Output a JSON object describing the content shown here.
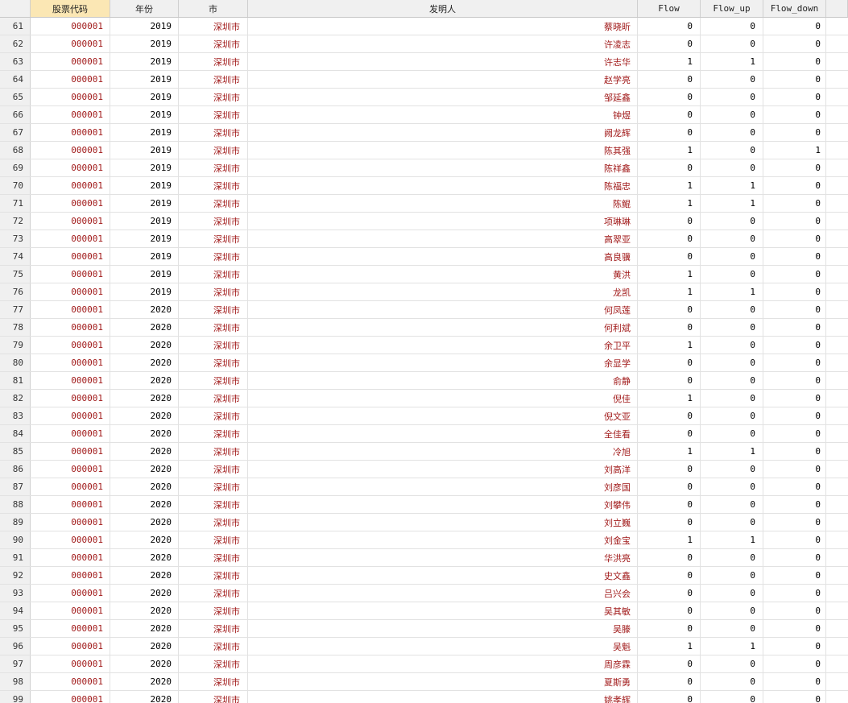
{
  "columns": {
    "code": "股票代码",
    "year": "年份",
    "city": "市",
    "inventor": "发明人",
    "flow": "Flow",
    "flow_up": "Flow_up",
    "flow_down": "Flow_down"
  },
  "rows": [
    {
      "idx": "61",
      "code": "000001",
      "year": "2019",
      "city": "深圳市",
      "inventor": "蔡晓昕",
      "flow": "0",
      "up": "0",
      "down": "0"
    },
    {
      "idx": "62",
      "code": "000001",
      "year": "2019",
      "city": "深圳市",
      "inventor": "许凌志",
      "flow": "0",
      "up": "0",
      "down": "0"
    },
    {
      "idx": "63",
      "code": "000001",
      "year": "2019",
      "city": "深圳市",
      "inventor": "许志华",
      "flow": "1",
      "up": "1",
      "down": "0"
    },
    {
      "idx": "64",
      "code": "000001",
      "year": "2019",
      "city": "深圳市",
      "inventor": "赵学亮",
      "flow": "0",
      "up": "0",
      "down": "0"
    },
    {
      "idx": "65",
      "code": "000001",
      "year": "2019",
      "city": "深圳市",
      "inventor": "邹延鑫",
      "flow": "0",
      "up": "0",
      "down": "0"
    },
    {
      "idx": "66",
      "code": "000001",
      "year": "2019",
      "city": "深圳市",
      "inventor": "钟煜",
      "flow": "0",
      "up": "0",
      "down": "0"
    },
    {
      "idx": "67",
      "code": "000001",
      "year": "2019",
      "city": "深圳市",
      "inventor": "阙龙辉",
      "flow": "0",
      "up": "0",
      "down": "0"
    },
    {
      "idx": "68",
      "code": "000001",
      "year": "2019",
      "city": "深圳市",
      "inventor": "陈其强",
      "flow": "1",
      "up": "0",
      "down": "1"
    },
    {
      "idx": "69",
      "code": "000001",
      "year": "2019",
      "city": "深圳市",
      "inventor": "陈祥鑫",
      "flow": "0",
      "up": "0",
      "down": "0"
    },
    {
      "idx": "70",
      "code": "000001",
      "year": "2019",
      "city": "深圳市",
      "inventor": "陈福忠",
      "flow": "1",
      "up": "1",
      "down": "0"
    },
    {
      "idx": "71",
      "code": "000001",
      "year": "2019",
      "city": "深圳市",
      "inventor": "陈鲲",
      "flow": "1",
      "up": "1",
      "down": "0"
    },
    {
      "idx": "72",
      "code": "000001",
      "year": "2019",
      "city": "深圳市",
      "inventor": "项琳琳",
      "flow": "0",
      "up": "0",
      "down": "0"
    },
    {
      "idx": "73",
      "code": "000001",
      "year": "2019",
      "city": "深圳市",
      "inventor": "高翠亚",
      "flow": "0",
      "up": "0",
      "down": "0"
    },
    {
      "idx": "74",
      "code": "000001",
      "year": "2019",
      "city": "深圳市",
      "inventor": "高良骥",
      "flow": "0",
      "up": "0",
      "down": "0"
    },
    {
      "idx": "75",
      "code": "000001",
      "year": "2019",
      "city": "深圳市",
      "inventor": "黄洪",
      "flow": "1",
      "up": "0",
      "down": "0"
    },
    {
      "idx": "76",
      "code": "000001",
      "year": "2019",
      "city": "深圳市",
      "inventor": "龙凯",
      "flow": "1",
      "up": "1",
      "down": "0"
    },
    {
      "idx": "77",
      "code": "000001",
      "year": "2020",
      "city": "深圳市",
      "inventor": "何凤莲",
      "flow": "0",
      "up": "0",
      "down": "0"
    },
    {
      "idx": "78",
      "code": "000001",
      "year": "2020",
      "city": "深圳市",
      "inventor": "何利斌",
      "flow": "0",
      "up": "0",
      "down": "0"
    },
    {
      "idx": "79",
      "code": "000001",
      "year": "2020",
      "city": "深圳市",
      "inventor": "余卫平",
      "flow": "1",
      "up": "0",
      "down": "0"
    },
    {
      "idx": "80",
      "code": "000001",
      "year": "2020",
      "city": "深圳市",
      "inventor": "余显学",
      "flow": "0",
      "up": "0",
      "down": "0"
    },
    {
      "idx": "81",
      "code": "000001",
      "year": "2020",
      "city": "深圳市",
      "inventor": "俞静",
      "flow": "0",
      "up": "0",
      "down": "0"
    },
    {
      "idx": "82",
      "code": "000001",
      "year": "2020",
      "city": "深圳市",
      "inventor": "倪佳",
      "flow": "1",
      "up": "0",
      "down": "0"
    },
    {
      "idx": "83",
      "code": "000001",
      "year": "2020",
      "city": "深圳市",
      "inventor": "倪文亚",
      "flow": "0",
      "up": "0",
      "down": "0"
    },
    {
      "idx": "84",
      "code": "000001",
      "year": "2020",
      "city": "深圳市",
      "inventor": "全佳看",
      "flow": "0",
      "up": "0",
      "down": "0"
    },
    {
      "idx": "85",
      "code": "000001",
      "year": "2020",
      "city": "深圳市",
      "inventor": "冷旭",
      "flow": "1",
      "up": "1",
      "down": "0"
    },
    {
      "idx": "86",
      "code": "000001",
      "year": "2020",
      "city": "深圳市",
      "inventor": "刘高洋",
      "flow": "0",
      "up": "0",
      "down": "0"
    },
    {
      "idx": "87",
      "code": "000001",
      "year": "2020",
      "city": "深圳市",
      "inventor": "刘彦国",
      "flow": "0",
      "up": "0",
      "down": "0"
    },
    {
      "idx": "88",
      "code": "000001",
      "year": "2020",
      "city": "深圳市",
      "inventor": "刘攀伟",
      "flow": "0",
      "up": "0",
      "down": "0"
    },
    {
      "idx": "89",
      "code": "000001",
      "year": "2020",
      "city": "深圳市",
      "inventor": "刘立巍",
      "flow": "0",
      "up": "0",
      "down": "0"
    },
    {
      "idx": "90",
      "code": "000001",
      "year": "2020",
      "city": "深圳市",
      "inventor": "刘金宝",
      "flow": "1",
      "up": "1",
      "down": "0"
    },
    {
      "idx": "91",
      "code": "000001",
      "year": "2020",
      "city": "深圳市",
      "inventor": "华洪亮",
      "flow": "0",
      "up": "0",
      "down": "0"
    },
    {
      "idx": "92",
      "code": "000001",
      "year": "2020",
      "city": "深圳市",
      "inventor": "史文鑫",
      "flow": "0",
      "up": "0",
      "down": "0"
    },
    {
      "idx": "93",
      "code": "000001",
      "year": "2020",
      "city": "深圳市",
      "inventor": "吕兴会",
      "flow": "0",
      "up": "0",
      "down": "0"
    },
    {
      "idx": "94",
      "code": "000001",
      "year": "2020",
      "city": "深圳市",
      "inventor": "吴其敏",
      "flow": "0",
      "up": "0",
      "down": "0"
    },
    {
      "idx": "95",
      "code": "000001",
      "year": "2020",
      "city": "深圳市",
      "inventor": "吴滕",
      "flow": "0",
      "up": "0",
      "down": "0"
    },
    {
      "idx": "96",
      "code": "000001",
      "year": "2020",
      "city": "深圳市",
      "inventor": "吴魁",
      "flow": "1",
      "up": "1",
      "down": "0"
    },
    {
      "idx": "97",
      "code": "000001",
      "year": "2020",
      "city": "深圳市",
      "inventor": "周彦霖",
      "flow": "0",
      "up": "0",
      "down": "0"
    },
    {
      "idx": "98",
      "code": "000001",
      "year": "2020",
      "city": "深圳市",
      "inventor": "夏斯勇",
      "flow": "0",
      "up": "0",
      "down": "0"
    },
    {
      "idx": "99",
      "code": "000001",
      "year": "2020",
      "city": "深圳市",
      "inventor": "姚孝辉",
      "flow": "0",
      "up": "0",
      "down": "0"
    }
  ]
}
